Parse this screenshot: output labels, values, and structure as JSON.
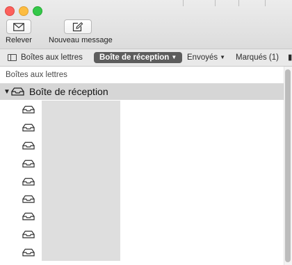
{
  "toolbar": {
    "get_mail_label": "Relever",
    "compose_label": "Nouveau message"
  },
  "favorites": {
    "mailboxes_label": "Boîtes aux lettres",
    "inbox_label": "Boîte de réception",
    "sent_label": "Envoyés",
    "flagged_label": "Marqués (1)"
  },
  "sidebar": {
    "section_title": "Boîtes aux lettres",
    "inbox_label": "Boîte de réception",
    "sub_mailbox_count": 9
  },
  "icons": {
    "get_mail": "envelope-icon",
    "compose": "compose-icon",
    "mailbox": "tray-icon"
  },
  "colors": {
    "selected_pill": "#5d5d5d",
    "selected_row": "#d6d6d6",
    "close": "#fc605c",
    "minimize": "#fdbc40",
    "zoom": "#34c84a"
  }
}
